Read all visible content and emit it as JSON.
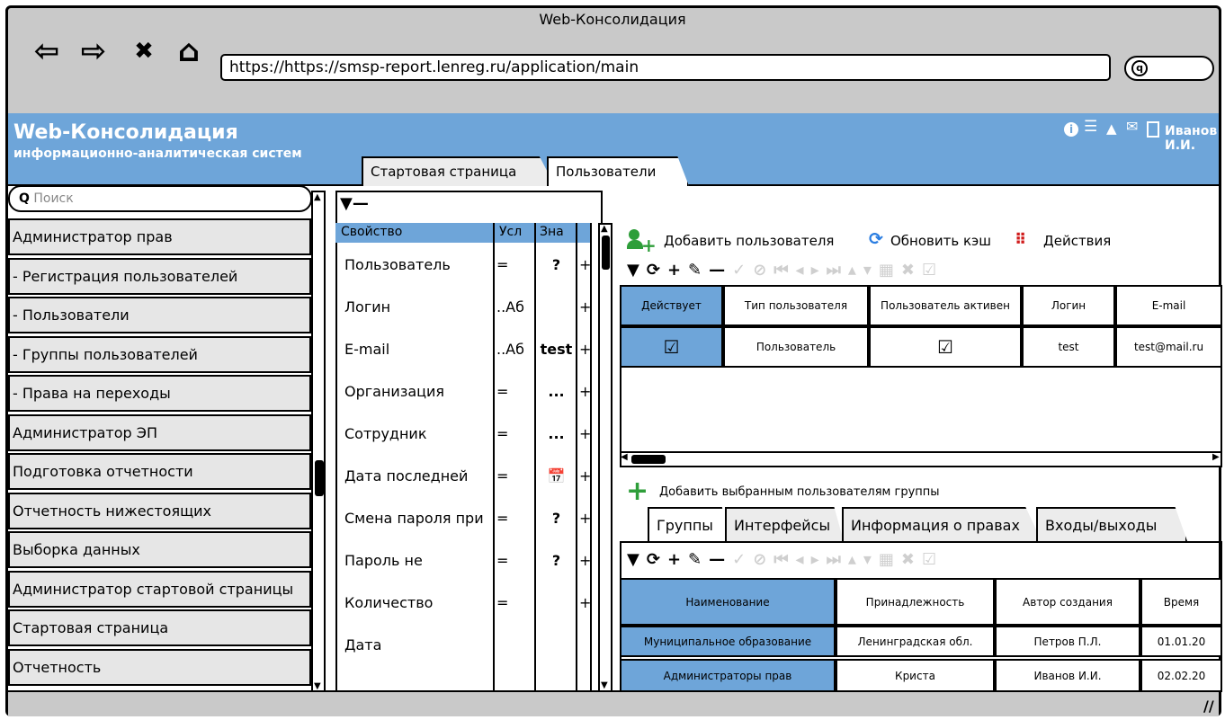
{
  "window": {
    "title": "Web-Консолидация",
    "url": "https://https://smsp-report.lenreg.ru/application/main",
    "nav": {
      "back": "⇦",
      "forward": "⇨",
      "close": "✖",
      "home": "⌂"
    }
  },
  "app": {
    "title": "Web-Консолидация",
    "subtitle": "информационно-аналитическая систем",
    "user": "Иванов И.И.",
    "tabs": [
      {
        "label": "Стартовая страница"
      },
      {
        "label": "Пользователи"
      }
    ]
  },
  "sidebar": {
    "search_placeholder": "Поиск",
    "items": [
      "Администратор прав",
      "- Регистрация пользователей",
      "- Пользователи",
      "- Группы пользователей",
      "- Права на переходы",
      "Администратор ЭП",
      "Подготовка отчетности",
      "Отчетность нижестоящих",
      "Выборка данных",
      "Администратор стартовой страницы",
      "Стартовая страница",
      "Отчетность"
    ]
  },
  "filter_panel": {
    "headers": {
      "property": "Свойство",
      "cond": "Усл",
      "value": "Зна"
    },
    "rows": [
      {
        "property": "Пользователь",
        "cond": "=",
        "value": "?",
        "add": "+"
      },
      {
        "property": "Логин",
        "cond": "..Аб",
        "value": "",
        "add": "+"
      },
      {
        "property": "E-mail",
        "cond": "..Аб",
        "value": "test",
        "add": "+"
      },
      {
        "property": "Организация",
        "cond": "=",
        "value": "...",
        "add": "+"
      },
      {
        "property": "Сотрудник",
        "cond": "=",
        "value": "...",
        "add": "+"
      },
      {
        "property": "Дата последней",
        "cond": "=",
        "value": "📅",
        "add": "+"
      },
      {
        "property": "Смена пароля при",
        "cond": "=",
        "value": "?",
        "add": "+"
      },
      {
        "property": "Пароль не",
        "cond": "=",
        "value": "?",
        "add": "+"
      },
      {
        "property": "Количество",
        "cond": "=",
        "value": "",
        "add": "+"
      },
      {
        "property": "Дата",
        "cond": "",
        "value": "",
        "add": ""
      }
    ]
  },
  "users": {
    "actions": {
      "add": "Добавить пользователя",
      "refresh": "Обновить кэш",
      "menu": "Действия"
    },
    "columns": [
      "Действует",
      "Тип пользователя",
      "Пользователь активен",
      "Логин",
      "E-mail"
    ],
    "rows": [
      {
        "active": "☑",
        "type": "Пользователь",
        "user_active": "☑",
        "login": "test",
        "email": "test@mail.ru"
      }
    ]
  },
  "groups": {
    "add_label": "Добавить выбранным пользователям группы",
    "tabs": [
      "Группы",
      "Интерфейсы",
      "Информация о правах",
      "Входы/выходы"
    ],
    "columns": [
      "Наименование",
      "Принадлежность",
      "Автор создания",
      "Время"
    ],
    "rows": [
      {
        "name": "Муниципальное образование",
        "belongs": "Ленинградская обл.",
        "author": "Петров П.Л.",
        "time": "01.01.20"
      },
      {
        "name": "Администраторы прав",
        "belongs": "Криста",
        "author": "Иванов И.И.",
        "time": "02.02.20"
      }
    ]
  },
  "colors": {
    "accent": "#6ea5d9",
    "chrome": "#c9c9c9",
    "add_green": "#2e9e3a",
    "actions_red": "#d01c1c",
    "refresh_blue": "#2a7de1"
  }
}
